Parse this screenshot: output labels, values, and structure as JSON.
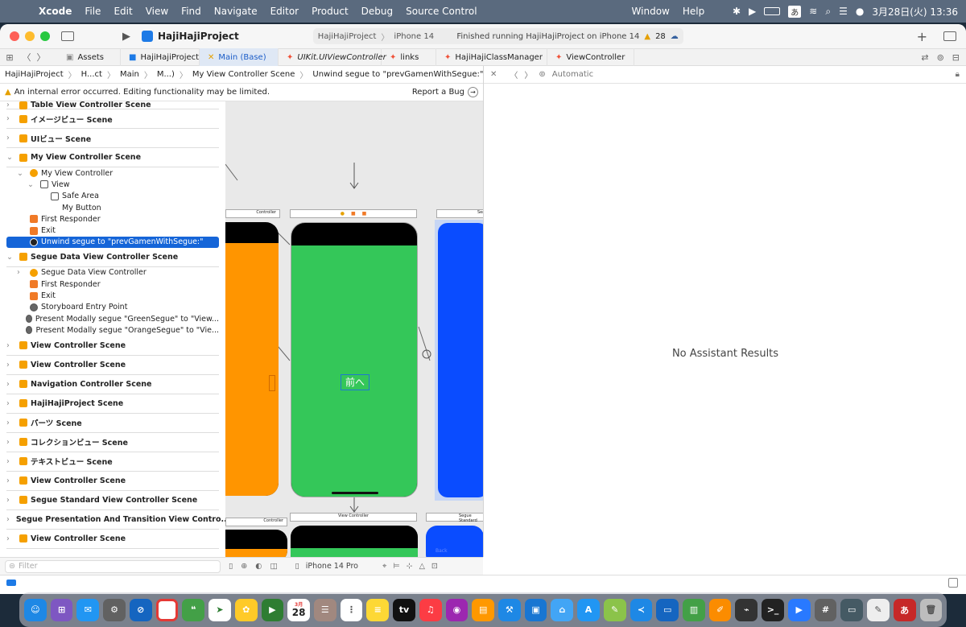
{
  "menubar": {
    "app": "Xcode",
    "items": [
      "File",
      "Edit",
      "View",
      "Find",
      "Navigate",
      "Editor",
      "Product",
      "Debug",
      "Source Control"
    ],
    "window": "Window",
    "help": "Help",
    "ime": "あ",
    "datetime": "3月28日(火)  13:36"
  },
  "toolbar": {
    "project": "HajiHajiProject",
    "scheme": "HajiHajiProject",
    "device": "iPhone 14",
    "status": "Finished running HajiHajiProject on iPhone 14",
    "warnings": "28"
  },
  "tabs": [
    "Assets",
    "HajiHajiProject",
    "Main (Base)",
    "UIKit.UIViewController",
    "links",
    "HajiHajiClassManager",
    "ViewController"
  ],
  "jumpbar": [
    "HajiHajiProject",
    "H...ct",
    "Main",
    "M...)",
    "My View Controller Scene",
    "Unwind segue to \"prevGamenWithSegue:\""
  ],
  "warning": {
    "text": "An internal error occurred. Editing functionality may be limited.",
    "action": "Report a Bug"
  },
  "outline": [
    {
      "label": "Table View Controller Scene",
      "level": 0,
      "kind": "scene"
    },
    {
      "label": "イメージビュー Scene",
      "level": 0,
      "kind": "scene"
    },
    {
      "label": "UIビュー Scene",
      "level": 0,
      "kind": "scene"
    },
    {
      "label": "My View Controller Scene",
      "level": 0,
      "kind": "scene"
    },
    {
      "label": "My View Controller",
      "level": 1,
      "kind": "vc"
    },
    {
      "label": "View",
      "level": 2,
      "kind": "view"
    },
    {
      "label": "Safe Area",
      "level": 3,
      "kind": "safe"
    },
    {
      "label": "My Button",
      "level": 3,
      "kind": "button"
    },
    {
      "label": "First Responder",
      "level": 1,
      "kind": "responder"
    },
    {
      "label": "Exit",
      "level": 1,
      "kind": "exit"
    },
    {
      "label": "Unwind segue to \"prevGamenWithSegue:\"",
      "level": 1,
      "kind": "selected"
    },
    {
      "label": "Segue Data View Controller Scene",
      "level": 0,
      "kind": "scene"
    },
    {
      "label": "Segue Data View Controller",
      "level": 1,
      "kind": "vc"
    },
    {
      "label": "First Responder",
      "level": 1,
      "kind": "responder"
    },
    {
      "label": "Exit",
      "level": 1,
      "kind": "exit"
    },
    {
      "label": "Storyboard Entry Point",
      "level": 1,
      "kind": "segue"
    },
    {
      "label": "Present Modally segue \"GreenSegue\" to \"View...",
      "level": 1,
      "kind": "segue"
    },
    {
      "label": "Present Modally segue \"OrangeSegue\" to \"Vie...",
      "level": 1,
      "kind": "segue"
    },
    {
      "label": "View Controller Scene",
      "level": 0,
      "kind": "scene"
    },
    {
      "label": "View Controller Scene",
      "level": 0,
      "kind": "scene"
    },
    {
      "label": "Navigation Controller Scene",
      "level": 0,
      "kind": "scene"
    },
    {
      "label": "HajiHajiProject Scene",
      "level": 0,
      "kind": "scene"
    },
    {
      "label": "パーツ Scene",
      "level": 0,
      "kind": "scene"
    },
    {
      "label": "コレクションビュー Scene",
      "level": 0,
      "kind": "scene"
    },
    {
      "label": "テキストビュー Scene",
      "level": 0,
      "kind": "scene"
    },
    {
      "label": "View Controller Scene",
      "level": 0,
      "kind": "scene"
    },
    {
      "label": "Segue Standard View Controller Scene",
      "level": 0,
      "kind": "scene"
    },
    {
      "label": "Segue Presentation And Transition View Contro...",
      "level": 0,
      "kind": "scene"
    },
    {
      "label": "View Controller Scene",
      "level": 0,
      "kind": "scene"
    }
  ],
  "canvas": {
    "button_label": "前へ",
    "vc_label": "View Controller",
    "segue_label": "Segue Standard",
    "back_label": "Back",
    "controller_label": "Controller",
    "segue_head_label": "Segu"
  },
  "filter": {
    "placeholder": "Filter"
  },
  "bottombar": {
    "device": "iPhone 14 Pro"
  },
  "assistant": {
    "mode": "Automatic",
    "empty": "No Assistant Results"
  },
  "dock": {
    "calendar_month": "3月",
    "calendar_day": "28"
  }
}
